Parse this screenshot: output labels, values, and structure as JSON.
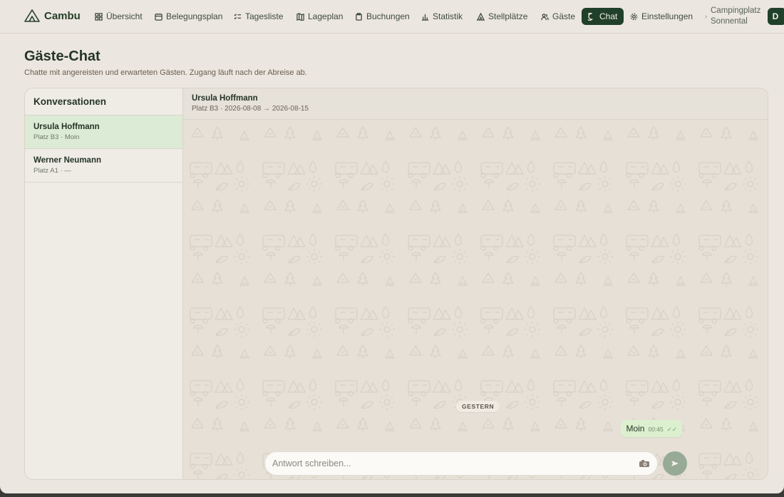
{
  "nav": {
    "brand": "Cambu",
    "items": [
      {
        "label": "Übersicht",
        "icon": "grid-icon"
      },
      {
        "label": "Belegungsplan",
        "icon": "calendar-icon"
      },
      {
        "label": "Tagesliste",
        "icon": "list-check-icon"
      },
      {
        "label": "Lageplan",
        "icon": "map-icon"
      },
      {
        "label": "Buchungen",
        "icon": "clipboard-icon"
      },
      {
        "label": "Statistik",
        "icon": "bar-chart-icon"
      },
      {
        "label": "Stellplätze",
        "icon": "tent-icon"
      },
      {
        "label": "Gäste",
        "icon": "users-icon"
      },
      {
        "label": "Chat",
        "icon": "chat-bubble-icon",
        "active": true
      },
      {
        "label": "Einstellungen",
        "icon": "gear-icon"
      }
    ],
    "campsite": "Campingplatz Sonnental",
    "avatar": "D"
  },
  "page": {
    "title": "Gäste-Chat",
    "subtitle": "Chatte mit angereisten und erwarteten Gästen. Zugang läuft nach der Abreise ab."
  },
  "sidebar": {
    "title": "Konversationen",
    "conversations": [
      {
        "name": "Ursula Hoffmann",
        "meta": "Platz B3 · Moin",
        "active": true
      },
      {
        "name": "Werner Neumann",
        "meta": "Platz A1 · —",
        "active": false
      }
    ]
  },
  "chat": {
    "name": "Ursula Hoffmann",
    "meta": "Platz B3 · 2026-08-08 → 2026-08-15",
    "day_label": "GESTERN",
    "messages": [
      {
        "text": "Moin",
        "time": "00:45",
        "status": "✓✓"
      }
    ],
    "composer_placeholder": "Antwort schreiben..."
  },
  "colors": {
    "accent": "#20402a",
    "active_conversation": "#dcebd6",
    "own_bubble": "#dcf0cf",
    "send_button": "#97aa96"
  }
}
